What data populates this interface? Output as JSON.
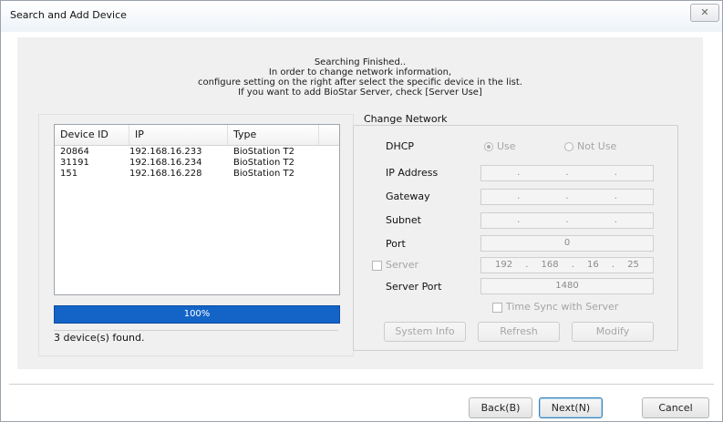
{
  "window": {
    "title": "Search and Add Device",
    "close_glyph": "✕"
  },
  "message": {
    "lines": [
      "Searching Finished..",
      "In order to change network information,",
      "configure setting on the right after select the specific device in the list.",
      "If you want to add BioStar Server, check [Server Use]"
    ]
  },
  "device_list": {
    "columns": [
      "Device ID",
      "IP",
      "Type"
    ],
    "rows": [
      [
        "20864",
        "192.168.16.233",
        "BioStation T2"
      ],
      [
        "31191",
        "192.168.16.234",
        "BioStation T2"
      ],
      [
        "151",
        "192.168.16.228",
        "BioStation T2"
      ]
    ]
  },
  "progress": {
    "label": "100%",
    "value": 100
  },
  "status": "3 device(s) found.",
  "change_network": {
    "title": "Change Network",
    "dhcp_label": "DHCP",
    "dhcp_use": "Use",
    "dhcp_not_use": "Not Use",
    "ip_address_label": "IP Address",
    "gateway_label": "Gateway",
    "subnet_label": "Subnet",
    "port_label": "Port",
    "port_value": "0",
    "server_label": "Server",
    "server_ip": [
      "192",
      "168",
      "16",
      "25"
    ],
    "server_port_label": "Server Port",
    "server_port_value": "1480",
    "time_sync_label": "Time Sync with Server",
    "system_info_button": "System Info",
    "refresh_button": "Refresh",
    "modify_button": "Modify"
  },
  "footer": {
    "back_button": "Back(B)",
    "next_button": "Next(N)",
    "cancel_button": "Cancel"
  },
  "colors": {
    "progress": "#1464c8",
    "accent_border": "#3c7fb1"
  }
}
